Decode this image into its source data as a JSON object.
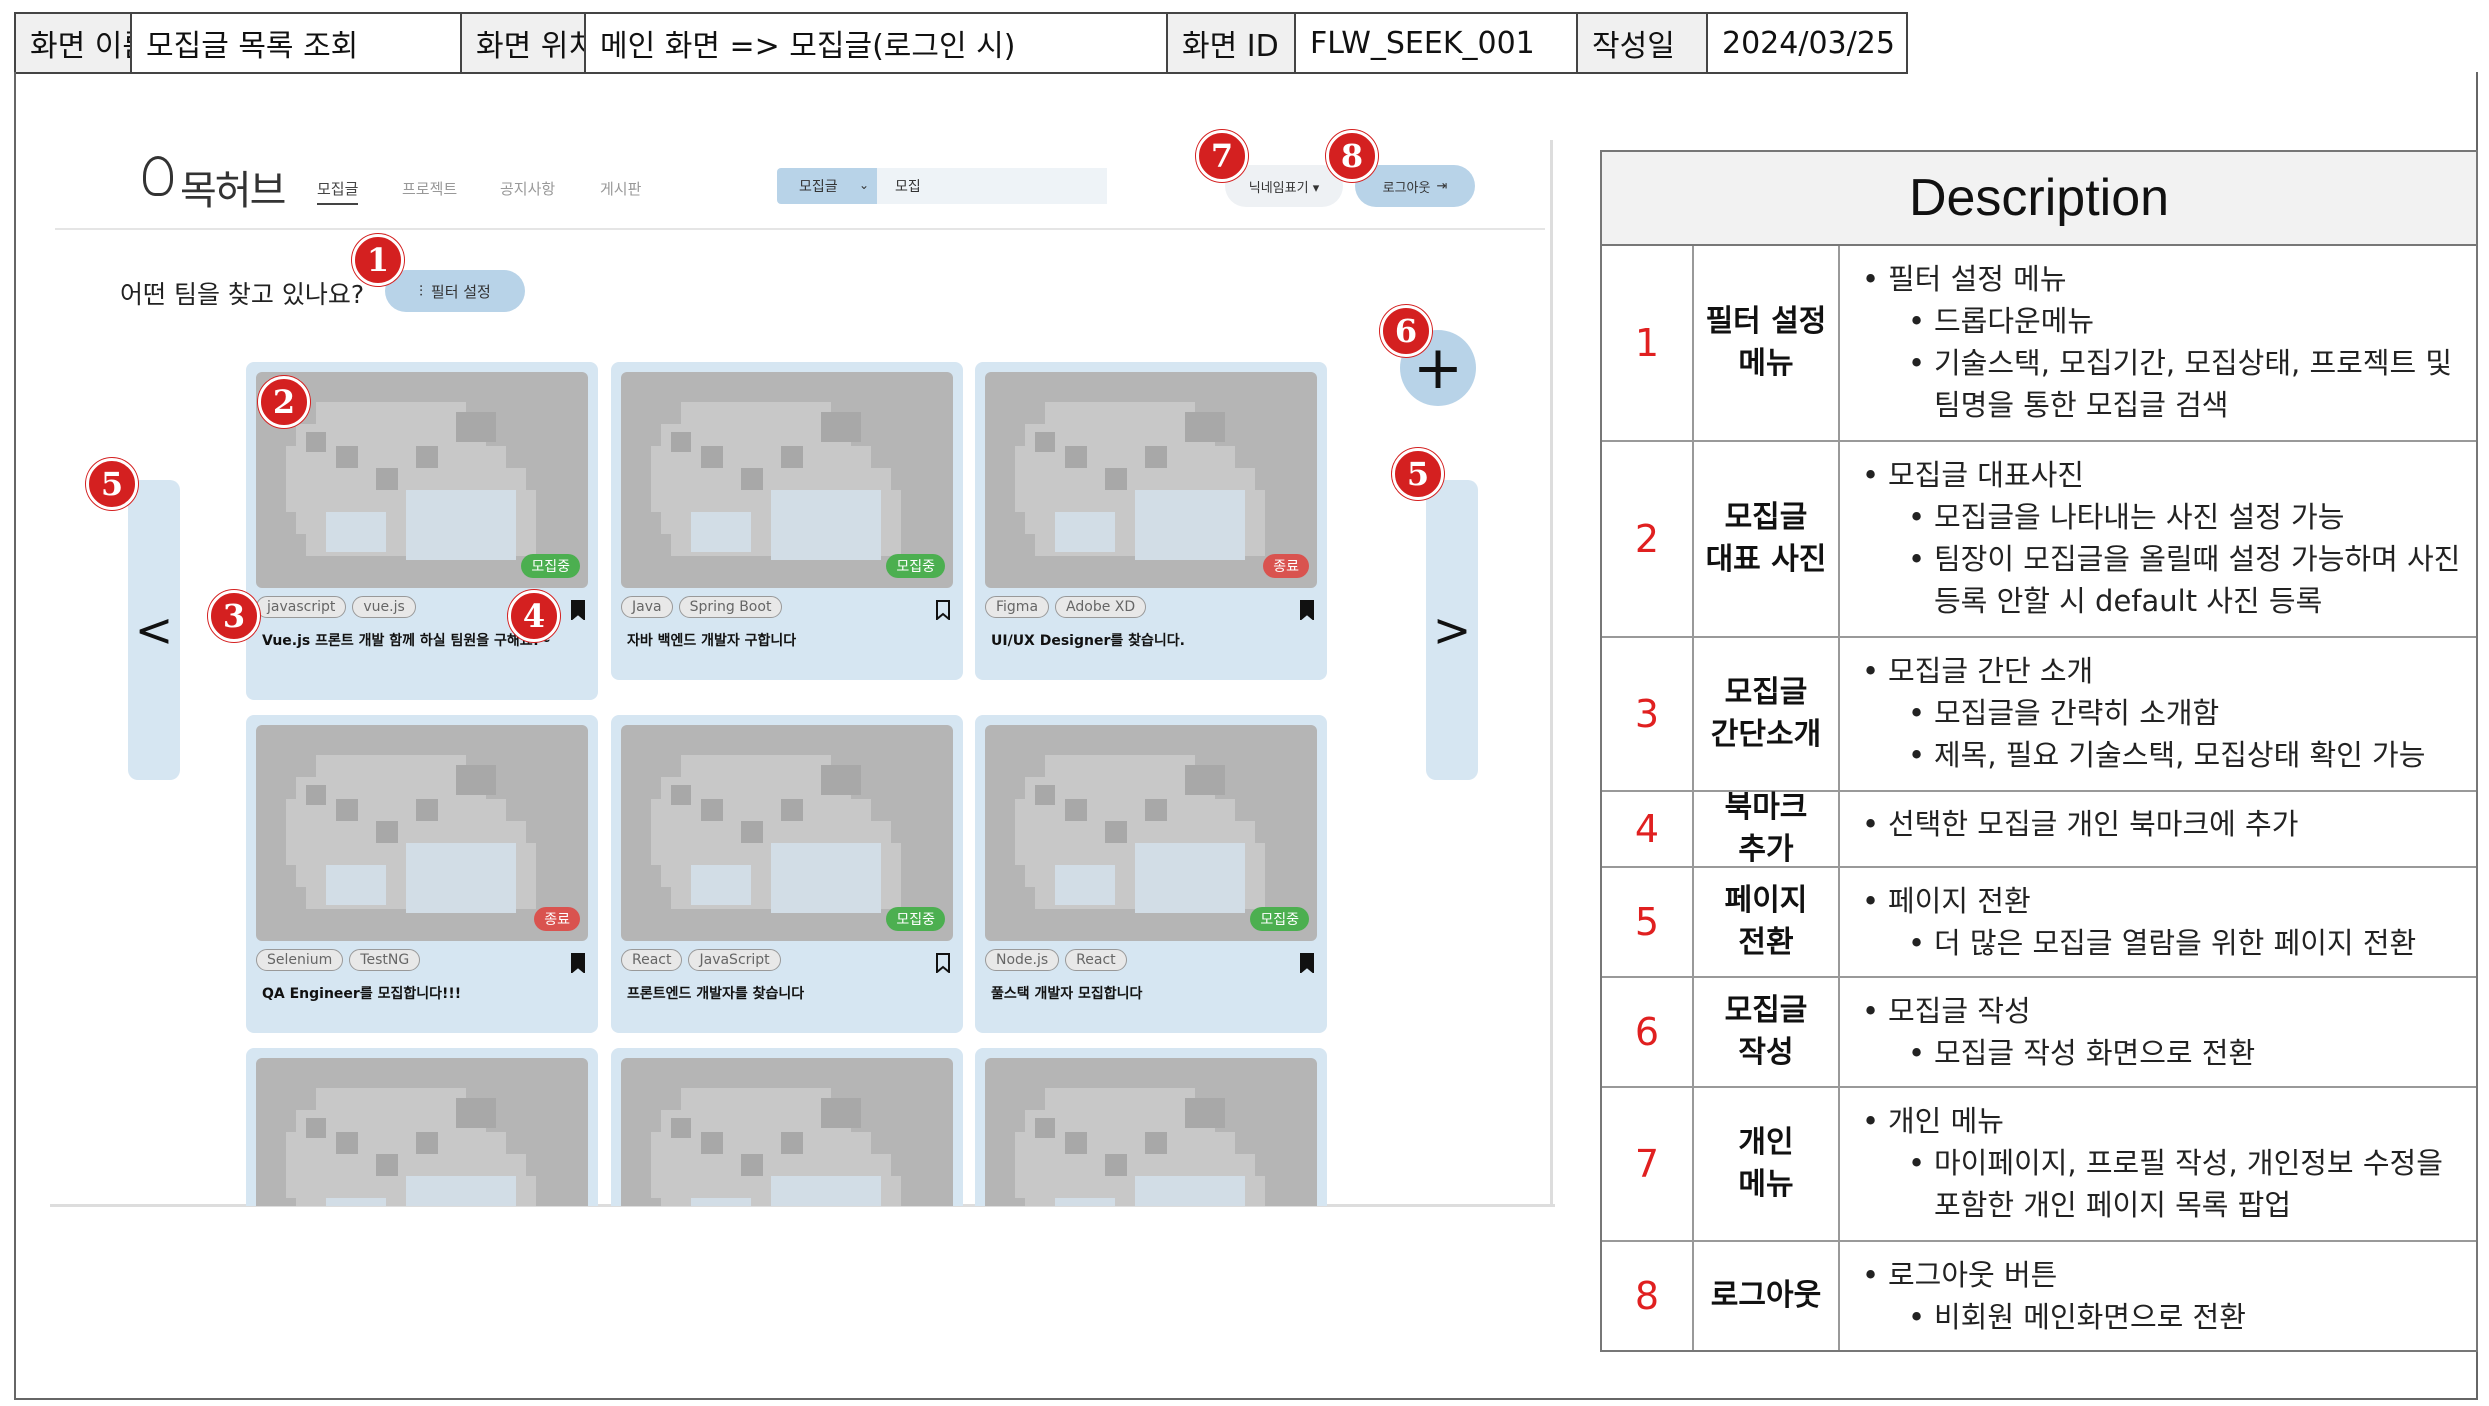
{
  "header": {
    "screen_name_label": "화면 이름",
    "screen_name": "모집글 목록 조회",
    "screen_location_label": "화면 위치",
    "screen_location": "메인 화면 => 모집글(로그인 시)",
    "screen_id_label": "화면 ID",
    "screen_id": "FLW_SEEK_001",
    "date_label": "작성일",
    "date": "2024/03/25"
  },
  "app": {
    "logo_text": "목허브",
    "nav": [
      "모집글",
      "프로젝트",
      "공지사항",
      "게시판"
    ],
    "search": {
      "select_value": "모집글",
      "input_value": "모집"
    },
    "nickname_button": "닉네임표기 ▾",
    "logout_button": "로그아웃",
    "question": "어떤 팀을 찾고 있나요?",
    "filter_button": "필터 설정",
    "add_button": "+",
    "prev_arrow": "<",
    "next_arrow": ">"
  },
  "cards": [
    {
      "status": "모집중",
      "status_type": "open",
      "tags": [
        "javascript",
        "vue.js"
      ],
      "bookmarked": true,
      "title": "Vue.js 프론트 개발 함께 하실 팀원을 구해요!~"
    },
    {
      "status": "모집중",
      "status_type": "open",
      "tags": [
        "Java",
        "Spring Boot"
      ],
      "bookmarked": false,
      "title": "자바 백엔드 개발자 구합니다"
    },
    {
      "status": "종료",
      "status_type": "closed",
      "tags": [
        "Figma",
        "Adobe XD"
      ],
      "bookmarked": true,
      "title": "UI/UX Designer를 찾습니다."
    },
    {
      "status": "종료",
      "status_type": "closed",
      "tags": [
        "Selenium",
        "TestNG"
      ],
      "bookmarked": true,
      "title": "QA Engineer를 모집합니다!!!"
    },
    {
      "status": "모집중",
      "status_type": "open",
      "tags": [
        "React",
        "JavaScript"
      ],
      "bookmarked": false,
      "title": "프론트엔드 개발자를 찾습니다"
    },
    {
      "status": "모집중",
      "status_type": "open",
      "tags": [
        "Node.js",
        "React"
      ],
      "bookmarked": true,
      "title": "풀스택 개발자 모집합니다"
    }
  ],
  "markers": [
    "1",
    "2",
    "3",
    "4",
    "5",
    "5",
    "6",
    "7",
    "8"
  ],
  "description": {
    "title": "Description",
    "rows": [
      {
        "num": "1",
        "name": "필터 설정\n메뉴",
        "items": [
          {
            "level": 1,
            "text": "필터 설정 메뉴"
          },
          {
            "level": 2,
            "text": "드롭다운메뉴"
          },
          {
            "level": 2,
            "text": "기술스택, 모집기간, 모집상태, 프로젝트 및 팀명을 통한 모집글 검색"
          }
        ]
      },
      {
        "num": "2",
        "name": "모집글\n대표 사진",
        "items": [
          {
            "level": 1,
            "text": "모집글 대표사진"
          },
          {
            "level": 2,
            "text": "모집글을 나타내는 사진 설정 가능"
          },
          {
            "level": 2,
            "text": "팀장이 모집글을 올릴때 설정 가능하며 사진 등록 안할 시 default 사진 등록"
          }
        ]
      },
      {
        "num": "3",
        "name": "모집글\n간단소개",
        "items": [
          {
            "level": 1,
            "text": "모집글 간단 소개"
          },
          {
            "level": 2,
            "text": "모집글을 간략히 소개함"
          },
          {
            "level": 2,
            "text": "제목, 필요 기술스택, 모집상태 확인 가능"
          }
        ]
      },
      {
        "num": "4",
        "name": "북마크\n추가",
        "items": [
          {
            "level": 1,
            "text": "선택한 모집글 개인 북마크에 추가"
          }
        ]
      },
      {
        "num": "5",
        "name": "페이지\n전환",
        "items": [
          {
            "level": 1,
            "text": "페이지 전환"
          },
          {
            "level": 2,
            "text": "더 많은 모집글 열람을 위한 페이지 전환"
          }
        ]
      },
      {
        "num": "6",
        "name": "모집글\n작성",
        "items": [
          {
            "level": 1,
            "text": "모집글 작성"
          },
          {
            "level": 2,
            "text": "모집글 작성 화면으로 전환"
          }
        ]
      },
      {
        "num": "7",
        "name": "개인\n메뉴",
        "items": [
          {
            "level": 1,
            "text": "개인 메뉴"
          },
          {
            "level": 2,
            "text": "마이페이지, 프로필 작성, 개인정보 수정을 포함한 개인 페이지 목록 팝업"
          }
        ]
      },
      {
        "num": "8",
        "name": "로그아웃",
        "items": [
          {
            "level": 1,
            "text": "로그아웃 버튼"
          },
          {
            "level": 2,
            "text": "비회원 메인화면으로 전환"
          }
        ]
      }
    ]
  },
  "colors": {
    "accent": "#b8d3e8",
    "card_bg": "#d6e6f2",
    "marker": "#d42020",
    "open": "#4caf50",
    "closed": "#d9534f"
  }
}
